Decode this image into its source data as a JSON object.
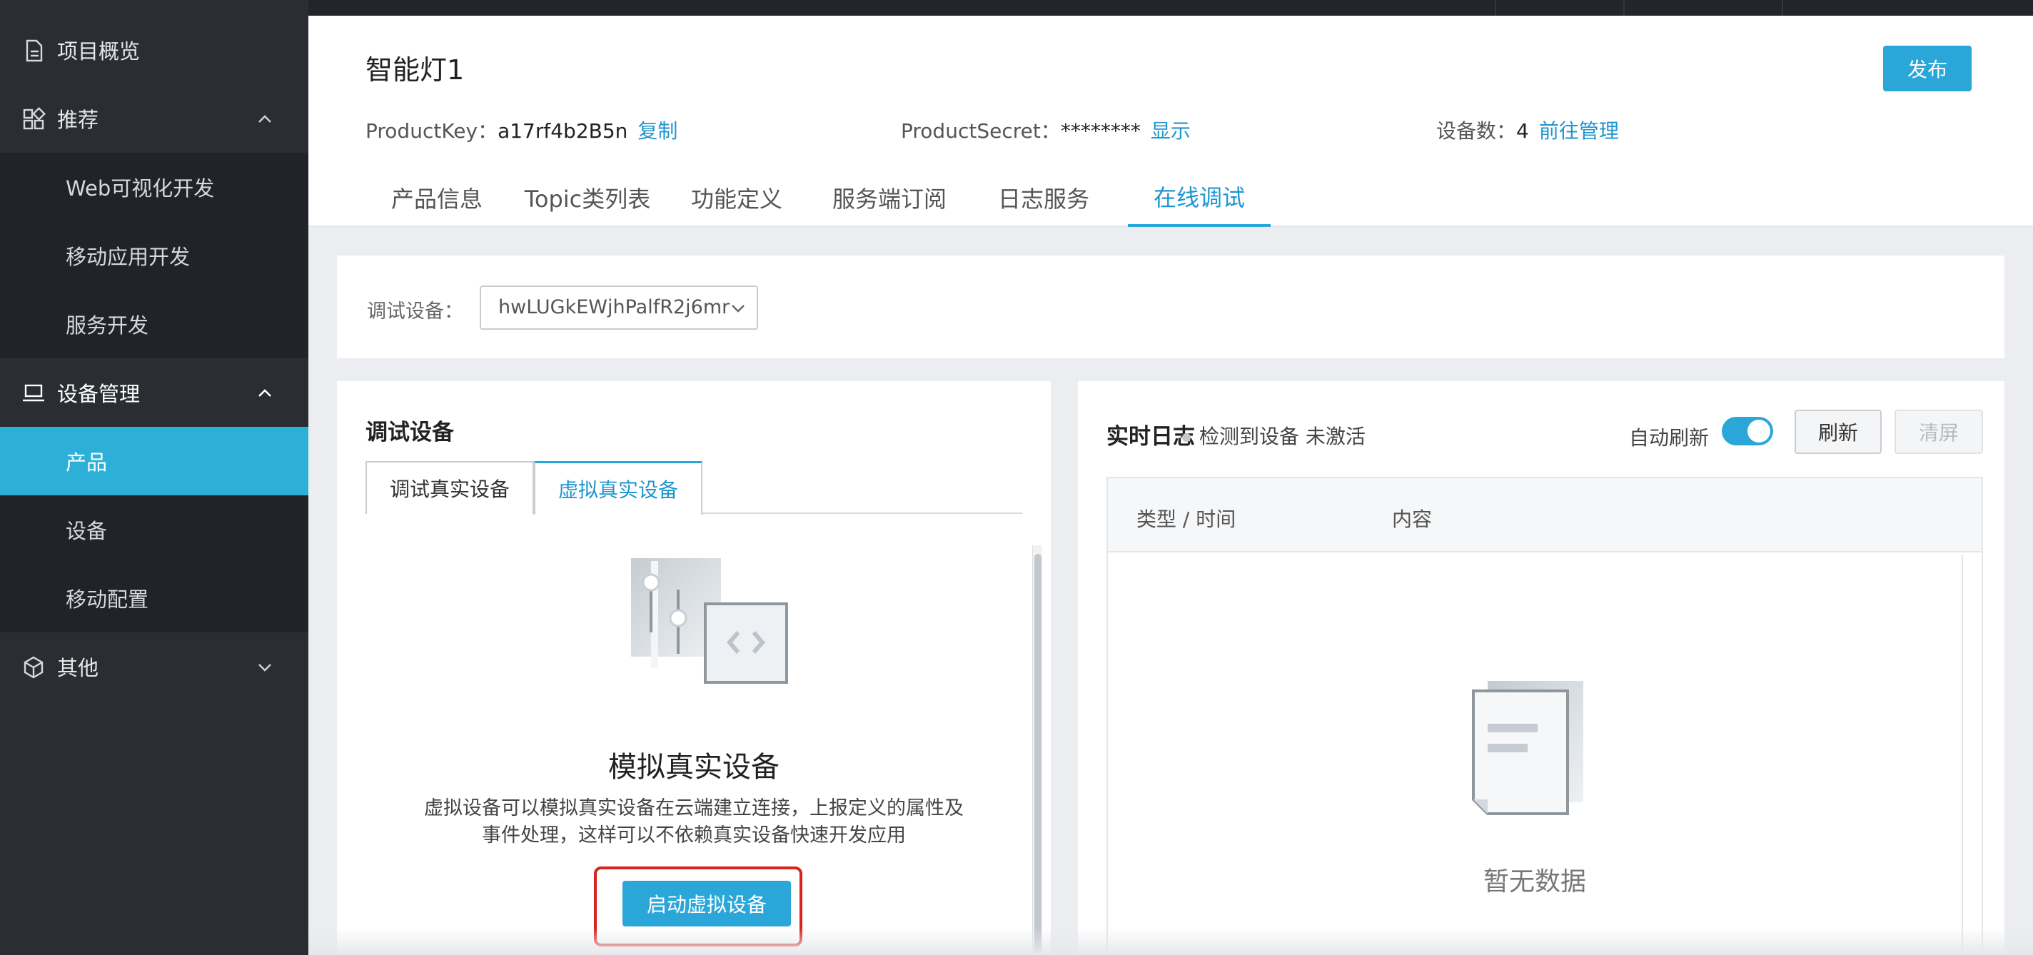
{
  "sidebar": {
    "items": [
      {
        "label": "项目概览",
        "icon": "document-icon"
      },
      {
        "label": "推荐",
        "icon": "apps-grid-icon",
        "expanded": true
      },
      {
        "label": "Web可视化开发"
      },
      {
        "label": "移动应用开发"
      },
      {
        "label": "服务开发"
      },
      {
        "label": "设备管理",
        "icon": "laptop-icon",
        "expanded": true
      },
      {
        "label": "产品",
        "active": true
      },
      {
        "label": "设备"
      },
      {
        "label": "移动配置"
      },
      {
        "label": "其他",
        "icon": "cube-icon",
        "expanded": false
      }
    ]
  },
  "header": {
    "title": "智能灯1",
    "publish_label": "发布",
    "product_key_label": "ProductKey：",
    "product_key_value": "a17rf4b2B5n",
    "copy_label": "复制",
    "product_secret_label": "ProductSecret：",
    "product_secret_value": "********",
    "show_label": "显示",
    "device_count_label": "设备数：",
    "device_count_value": "4",
    "manage_label": "前往管理"
  },
  "tabs": [
    {
      "label": "产品信息"
    },
    {
      "label": "Topic类列表"
    },
    {
      "label": "功能定义"
    },
    {
      "label": "服务端订阅"
    },
    {
      "label": "日志服务"
    },
    {
      "label": "在线调试",
      "active": true
    }
  ],
  "debug_bar": {
    "label": "调试设备：",
    "selected_device": "hwLUGkEWjhPalfR2j6mr"
  },
  "left_panel": {
    "title": "调试设备",
    "subtabs": [
      {
        "label": "调试真实设备"
      },
      {
        "label": "虚拟真实设备",
        "active": true
      }
    ],
    "virtual_title": "模拟真实设备",
    "virtual_desc_line1": "虚拟设备可以模拟真实设备在云端建立连接，上报定义的属性及",
    "virtual_desc_line2": "事件处理，这样可以不依赖真实设备快速开发应用",
    "start_button": "启动虚拟设备"
  },
  "right_panel": {
    "title": "实时日志",
    "status": "检测到设备 未激活",
    "auto_refresh_label": "自动刷新",
    "auto_refresh_on": true,
    "refresh_button": "刷新",
    "clear_button": "清屏",
    "columns": [
      "类型 / 时间",
      "内容"
    ],
    "empty_text": "暂无数据"
  },
  "colors": {
    "accent": "#2aa7d8",
    "link": "#1f95cf",
    "sidebar_bg": "#2a2e33",
    "highlight_border": "#d9221c"
  }
}
